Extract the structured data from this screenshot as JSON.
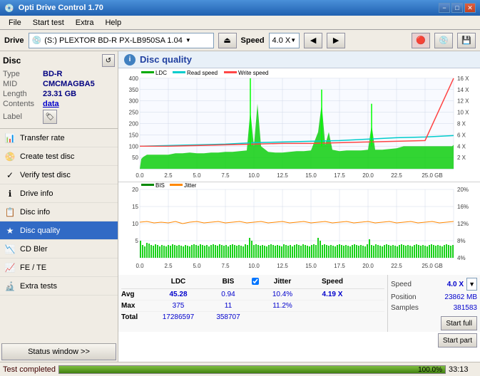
{
  "app": {
    "title": "Opti Drive Control 1.70",
    "icon": "💿"
  },
  "titlebar": {
    "minimize": "−",
    "maximize": "□",
    "close": "✕"
  },
  "menu": {
    "items": [
      "File",
      "Start test",
      "Extra",
      "Help"
    ]
  },
  "drive": {
    "label": "Drive",
    "selected": "(S:)  PLEXTOR BD-R  PX-LB950SA 1.04",
    "speed_label": "Speed",
    "speed_selected": "4.0 X",
    "eject_icon": "⏏",
    "left_icon": "◀",
    "right_icon": "▶",
    "refresh_icon": "↺"
  },
  "disc": {
    "title": "Disc",
    "type_label": "Type",
    "type_value": "BD-R",
    "mid_label": "MID",
    "mid_value": "CMCMAGBA5",
    "length_label": "Length",
    "length_value": "23.31 GB",
    "contents_label": "Contents",
    "contents_value": "data",
    "label_label": "Label",
    "label_icon": "🏷"
  },
  "nav": {
    "items": [
      {
        "id": "transfer-rate",
        "label": "Transfer rate",
        "icon": "📊",
        "active": false
      },
      {
        "id": "create-test-disc",
        "label": "Create test disc",
        "icon": "📀",
        "active": false
      },
      {
        "id": "verify-test-disc",
        "label": "Verify test disc",
        "icon": "✓",
        "active": false
      },
      {
        "id": "drive-info",
        "label": "Drive info",
        "icon": "ℹ",
        "active": false
      },
      {
        "id": "disc-info",
        "label": "Disc info",
        "icon": "📋",
        "active": false
      },
      {
        "id": "disc-quality",
        "label": "Disc quality",
        "icon": "★",
        "active": true
      },
      {
        "id": "cd-bler",
        "label": "CD Bler",
        "icon": "📉",
        "active": false
      },
      {
        "id": "fe-te",
        "label": "FE / TE",
        "icon": "📈",
        "active": false
      },
      {
        "id": "extra-tests",
        "label": "Extra tests",
        "icon": "🔬",
        "active": false
      }
    ]
  },
  "status_btn": "Status window >>",
  "disc_quality": {
    "title": "Disc quality",
    "icon": "i"
  },
  "chart_upper": {
    "legend": [
      {
        "label": "LDC",
        "color": "#00aa00"
      },
      {
        "label": "Read speed",
        "color": "#00cccc"
      },
      {
        "label": "Write speed",
        "color": "#ff4444"
      }
    ],
    "y_max": 400,
    "y_labels": [
      "400",
      "350",
      "300",
      "250",
      "200",
      "150",
      "100",
      "50"
    ],
    "y_right_labels": [
      "16 X",
      "14 X",
      "12 X",
      "10 X",
      "8 X",
      "6 X",
      "4 X",
      "2 X"
    ],
    "x_labels": [
      "0.0",
      "2.5",
      "5.0",
      "7.5",
      "10.0",
      "12.5",
      "15.0",
      "17.5",
      "20.0",
      "22.5",
      "25.0 GB"
    ]
  },
  "chart_lower": {
    "legend": [
      {
        "label": "BIS",
        "color": "#008800"
      },
      {
        "label": "Jitter",
        "color": "#ff8800"
      }
    ],
    "y_max": 20,
    "y_labels": [
      "20",
      "15",
      "10",
      "5"
    ],
    "y_right_labels": [
      "20%",
      "16%",
      "12%",
      "8%",
      "4%"
    ],
    "x_labels": [
      "0.0",
      "2.5",
      "5.0",
      "7.5",
      "10.0",
      "12.5",
      "15.0",
      "17.5",
      "20.0",
      "22.5",
      "25.0 GB"
    ]
  },
  "stats": {
    "headers": [
      "",
      "LDC",
      "BIS",
      "",
      "Jitter",
      "Speed",
      ""
    ],
    "avg_label": "Avg",
    "avg_ldc": "45.28",
    "avg_bis": "0.94",
    "avg_jitter": "10.4%",
    "avg_speed": "4.19 X",
    "max_label": "Max",
    "max_ldc": "375",
    "max_bis": "11",
    "max_jitter": "11.2%",
    "total_label": "Total",
    "total_ldc": "17286597",
    "total_bis": "358707",
    "jitter_label": "✓ Jitter",
    "speed_label": "Speed",
    "speed_value": "4.0 X",
    "position_label": "Position",
    "position_value": "23862 MB",
    "samples_label": "Samples",
    "samples_value": "381583",
    "btn_start_full": "Start full",
    "btn_start_part": "Start part"
  },
  "bottom_bar": {
    "status": "Test completed",
    "progress": 100,
    "progress_text": "100.0%",
    "time": "33:13"
  }
}
